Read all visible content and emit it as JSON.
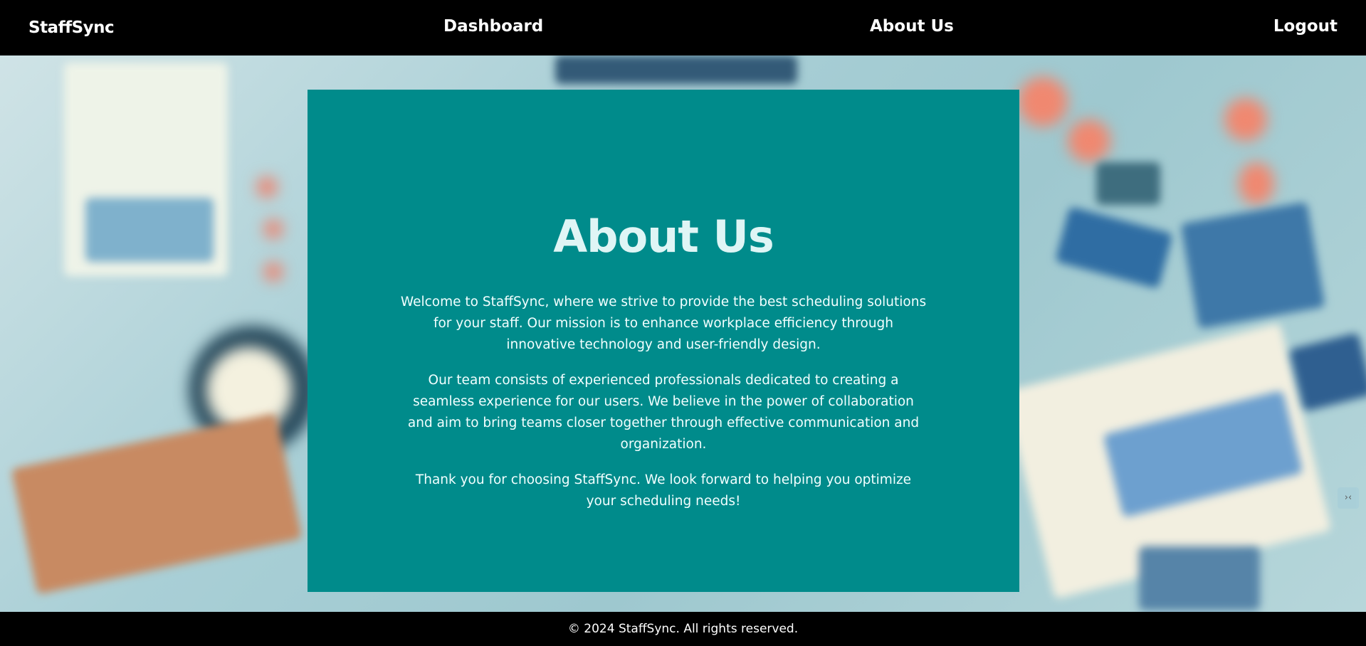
{
  "nav": {
    "brand": "StaffSync",
    "links": [
      "Dashboard",
      "About Us",
      "Logout"
    ]
  },
  "about": {
    "title": "About Us",
    "paragraphs": [
      "Welcome to StaffSync, where we strive to provide the best scheduling solutions for your staff. Our mission is to enhance workplace efficiency through innovative technology and user-friendly design.",
      "Our team consists of experienced professionals dedicated to creating a seamless experience for our users. We believe in the power of collaboration and aim to bring teams closer together through effective communication and organization.",
      "Thank you for choosing StaffSync. We look forward to helping you optimize your scheduling needs!"
    ]
  },
  "footer": {
    "text": "© 2024 StaffSync. All rights reserved."
  },
  "colors": {
    "nav_bg": "#000000",
    "card_bg": "#008b8b",
    "title": "#dff5f5"
  }
}
